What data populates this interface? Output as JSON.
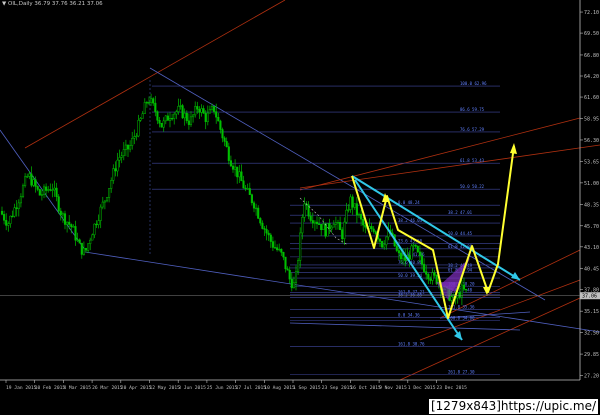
{
  "header": {
    "arrow": "▼",
    "symbol_line": "OIL,Daily  36.79 37.76 36.21 37.06"
  },
  "watermark": "[1279x843]https://upic.me/",
  "chart_data": {
    "type": "candlestick",
    "symbol": "OIL",
    "timeframe": "Daily",
    "ohlc_last": {
      "open": 36.79,
      "high": 37.76,
      "low": 36.21,
      "close": 37.06
    },
    "current_price_label": "37.06",
    "y_axis": {
      "ylim": [
        26.65,
        72.6
      ],
      "tick_labels": [
        "72.10",
        "69.50",
        "66.80",
        "64.20",
        "61.60",
        "58.95",
        "56.30",
        "53.65",
        "51.00",
        "48.35",
        "45.70",
        "43.10",
        "40.45",
        "37.80",
        "35.15",
        "32.50",
        "29.85",
        "27.20"
      ]
    },
    "x_axis": {
      "tick_labels": [
        "19 Jan 2015",
        "10 Feb 2015",
        "4 Mar 2015",
        "26 Mar 2015",
        "20 Apr 2015",
        "12 May 2015",
        "3 Jun 2015",
        "25 Jun 2015",
        "17 Jul 2015",
        "10 Aug 2015",
        "1 Sep 2015",
        "23 Sep 2015",
        "16 Oct 2015",
        "9 Nov 2015",
        "1 Dec 2015",
        "23 Dec 2015"
      ]
    },
    "price_path": [
      {
        "x": 0,
        "y": 47.5
      },
      {
        "x": 8,
        "y": 46.0
      },
      {
        "x": 18,
        "y": 48.8
      },
      {
        "x": 28,
        "y": 52.0
      },
      {
        "x": 40,
        "y": 49.5
      },
      {
        "x": 52,
        "y": 50.6
      },
      {
        "x": 62,
        "y": 47.0
      },
      {
        "x": 72,
        "y": 45.5
      },
      {
        "x": 80,
        "y": 43.0
      },
      {
        "x": 85,
        "y": 42.3
      },
      {
        "x": 92,
        "y": 45.0
      },
      {
        "x": 105,
        "y": 49.0
      },
      {
        "x": 118,
        "y": 54.0
      },
      {
        "x": 130,
        "y": 55.5
      },
      {
        "x": 140,
        "y": 58.5
      },
      {
        "x": 148,
        "y": 61.5
      },
      {
        "x": 155,
        "y": 60.0
      },
      {
        "x": 162,
        "y": 58.0
      },
      {
        "x": 170,
        "y": 59.5
      },
      {
        "x": 180,
        "y": 60.0
      },
      {
        "x": 190,
        "y": 58.5
      },
      {
        "x": 198,
        "y": 60.5
      },
      {
        "x": 206,
        "y": 59.0
      },
      {
        "x": 214,
        "y": 60.2
      },
      {
        "x": 222,
        "y": 57.0
      },
      {
        "x": 230,
        "y": 54.0
      },
      {
        "x": 238,
        "y": 52.0
      },
      {
        "x": 246,
        "y": 50.0
      },
      {
        "x": 254,
        "y": 48.5
      },
      {
        "x": 262,
        "y": 46.0
      },
      {
        "x": 272,
        "y": 43.5
      },
      {
        "x": 282,
        "y": 42.0
      },
      {
        "x": 290,
        "y": 39.0
      },
      {
        "x": 295,
        "y": 38.2
      },
      {
        "x": 300,
        "y": 44.0
      },
      {
        "x": 304,
        "y": 49.0
      },
      {
        "x": 310,
        "y": 47.0
      },
      {
        "x": 318,
        "y": 46.2
      },
      {
        "x": 326,
        "y": 45.0
      },
      {
        "x": 334,
        "y": 46.5
      },
      {
        "x": 342,
        "y": 44.5
      },
      {
        "x": 350,
        "y": 49.0
      },
      {
        "x": 358,
        "y": 47.0
      },
      {
        "x": 366,
        "y": 45.0
      },
      {
        "x": 374,
        "y": 45.5
      },
      {
        "x": 382,
        "y": 43.5
      },
      {
        "x": 390,
        "y": 45.0
      },
      {
        "x": 398,
        "y": 42.0
      },
      {
        "x": 406,
        "y": 41.5
      },
      {
        "x": 414,
        "y": 43.0
      },
      {
        "x": 422,
        "y": 41.0
      },
      {
        "x": 430,
        "y": 39.5
      },
      {
        "x": 438,
        "y": 39.0
      },
      {
        "x": 446,
        "y": 37.5
      },
      {
        "x": 454,
        "y": 36.5
      },
      {
        "x": 462,
        "y": 37.8
      },
      {
        "x": 470,
        "y": 37.06
      }
    ],
    "fib_labels": [
      {
        "text": "100.0 62.96",
        "price": 62.96
      },
      {
        "text": "86.6 59.75",
        "price": 59.75
      },
      {
        "text": "76.6 57.29",
        "price": 57.29
      },
      {
        "text": "61.8 53.43",
        "price": 53.43
      },
      {
        "text": "50.0 50.22",
        "price": 50.22
      },
      {
        "text": "0.0 48.24",
        "price": 48.24
      },
      {
        "text": "38.2 47.01",
        "price": 47.01
      },
      {
        "text": "38.2 46.03",
        "price": 46.03
      },
      {
        "text": "50.0 44.45",
        "price": 44.45
      },
      {
        "text": "23.6 43.50",
        "price": 43.5
      },
      {
        "text": "61.8 42.86",
        "price": 42.86
      },
      {
        "text": "100.0 41.86",
        "price": 41.86
      },
      {
        "text": "38.2 40.49",
        "price": 40.49
      },
      {
        "text": "76.6 40.86",
        "price": 40.86
      },
      {
        "text": "61.8 39.94",
        "price": 39.94
      },
      {
        "text": "50.0 39.24",
        "price": 39.24
      },
      {
        "text": "100.0 38.20",
        "price": 38.2
      },
      {
        "text": "161.8 37.21",
        "price": 37.21
      },
      {
        "text": "23.6 37.48",
        "price": 37.48
      },
      {
        "text": "38.2 36.85",
        "price": 36.85
      },
      {
        "text": "161.8 35.36",
        "price": 35.36
      },
      {
        "text": "0.0 34.36",
        "price": 34.36
      },
      {
        "text": "100.0 34.00",
        "price": 34.0
      },
      {
        "text": "161.8 30.76",
        "price": 30.76
      },
      {
        "text": "261.8 27.30",
        "price": 27.3
      }
    ],
    "colors": {
      "background": "#000000",
      "candles": "#00c000",
      "trendlines_red": "#b03010",
      "trendlines_blue": "#5060c0",
      "fib_lines": "#4048a0",
      "fib_text": "#6080ff",
      "pattern_yellow": "#ffff30",
      "channel_cyan": "#30c8e8",
      "pattern_purple": "#8030c0",
      "axis_text": "#c0c0c0"
    }
  }
}
